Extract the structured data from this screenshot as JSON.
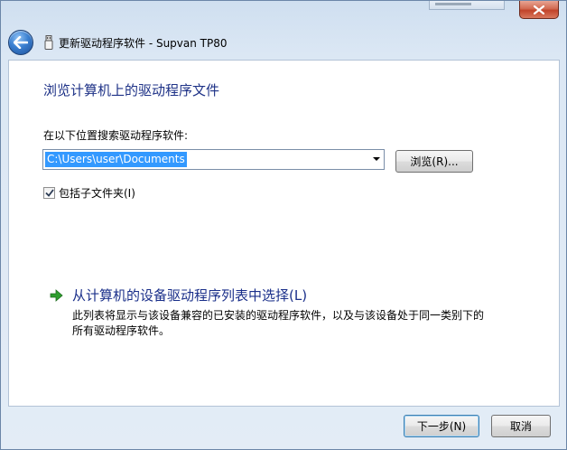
{
  "window": {
    "title": "更新驱动程序软件 - Supvan TP80"
  },
  "page": {
    "heading": "浏览计算机上的驱动程序文件",
    "search_label": "在以下位置搜索驱动程序软件:",
    "path_value": "C:\\Users\\user\\Documents",
    "browse_label": "浏览(R)...",
    "include_subfolders_label": "包括子文件夹(I)",
    "include_subfolders_checked": true,
    "pick_option_title": "从计算机的设备驱动程序列表中选择(L)",
    "pick_option_desc_line1": "此列表将显示与该设备兼容的已安装的驱动程序软件，以及与该设备处于同一类别下的",
    "pick_option_desc_line2": "所有驱动程序软件。"
  },
  "footer": {
    "next_label": "下一步(N)",
    "cancel_label": "取消"
  },
  "colors": {
    "heading": "#1e3287",
    "selection": "#3399ff",
    "close_red": "#c1432a",
    "arrow_green": "#2e9e2e"
  },
  "icons": {
    "close": "close-icon",
    "back": "back-arrow-icon",
    "device": "usb-device-icon",
    "option_arrow": "green-arrow-icon",
    "dropdown": "chevron-down-icon",
    "check": "check-icon"
  }
}
